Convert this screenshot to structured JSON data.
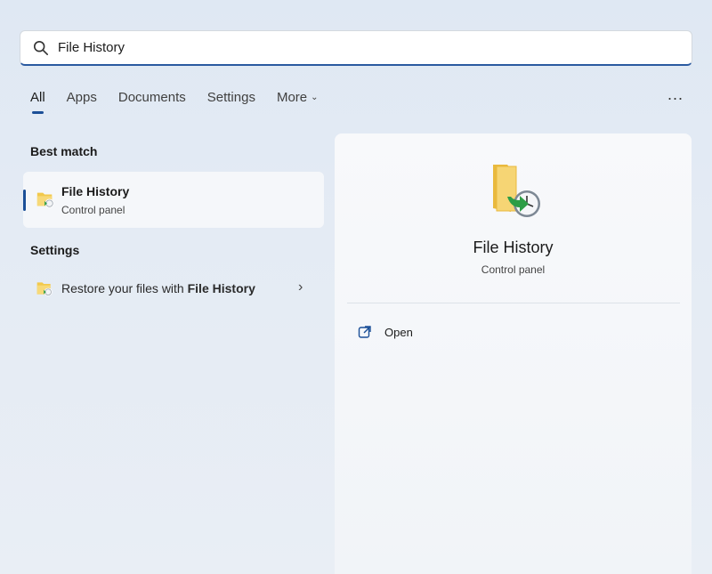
{
  "search": {
    "value": "File History"
  },
  "tabs": [
    {
      "label": "All",
      "active": true
    },
    {
      "label": "Apps"
    },
    {
      "label": "Documents"
    },
    {
      "label": "Settings"
    },
    {
      "label": "More"
    }
  ],
  "more_options": "...",
  "best_match": {
    "heading": "Best match",
    "title": "File History",
    "subtitle": "Control panel"
  },
  "settings_section": {
    "heading": "Settings",
    "item_prefix": "Restore your files with ",
    "item_bold": "File History"
  },
  "preview": {
    "title": "File History",
    "subtitle": "Control panel",
    "open_label": "Open"
  },
  "icons": {
    "search": "search-icon",
    "more": "chevron-down-icon",
    "file_history": "file-history-icon",
    "open": "open-external-icon",
    "arrow": "chevron-right-icon"
  },
  "colors": {
    "accent": "#1b4f97",
    "folder": "#f2c94c",
    "arrow_green": "#2e9d46"
  }
}
